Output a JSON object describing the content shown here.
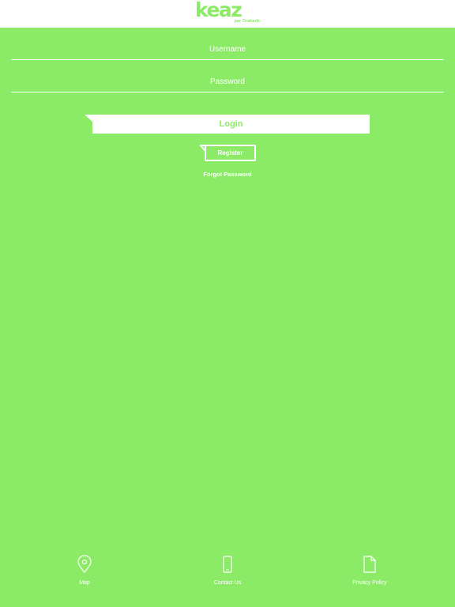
{
  "header": {
    "logo_text": "keaz",
    "logo_subtitle": "par Orabank"
  },
  "form": {
    "username_placeholder": "Username",
    "password_placeholder": "Password",
    "login_label": "Login",
    "register_label": "Register",
    "forgot_label": "Forgot Password"
  },
  "footer": {
    "items": [
      {
        "label": "Map",
        "icon": "map-pin-icon"
      },
      {
        "label": "Contact Us",
        "icon": "phone-icon"
      },
      {
        "label": "Privacy Policy",
        "icon": "document-icon"
      }
    ]
  },
  "colors": {
    "background": "#8ceb66",
    "header": "#ffffff",
    "text": "#ffffff"
  }
}
